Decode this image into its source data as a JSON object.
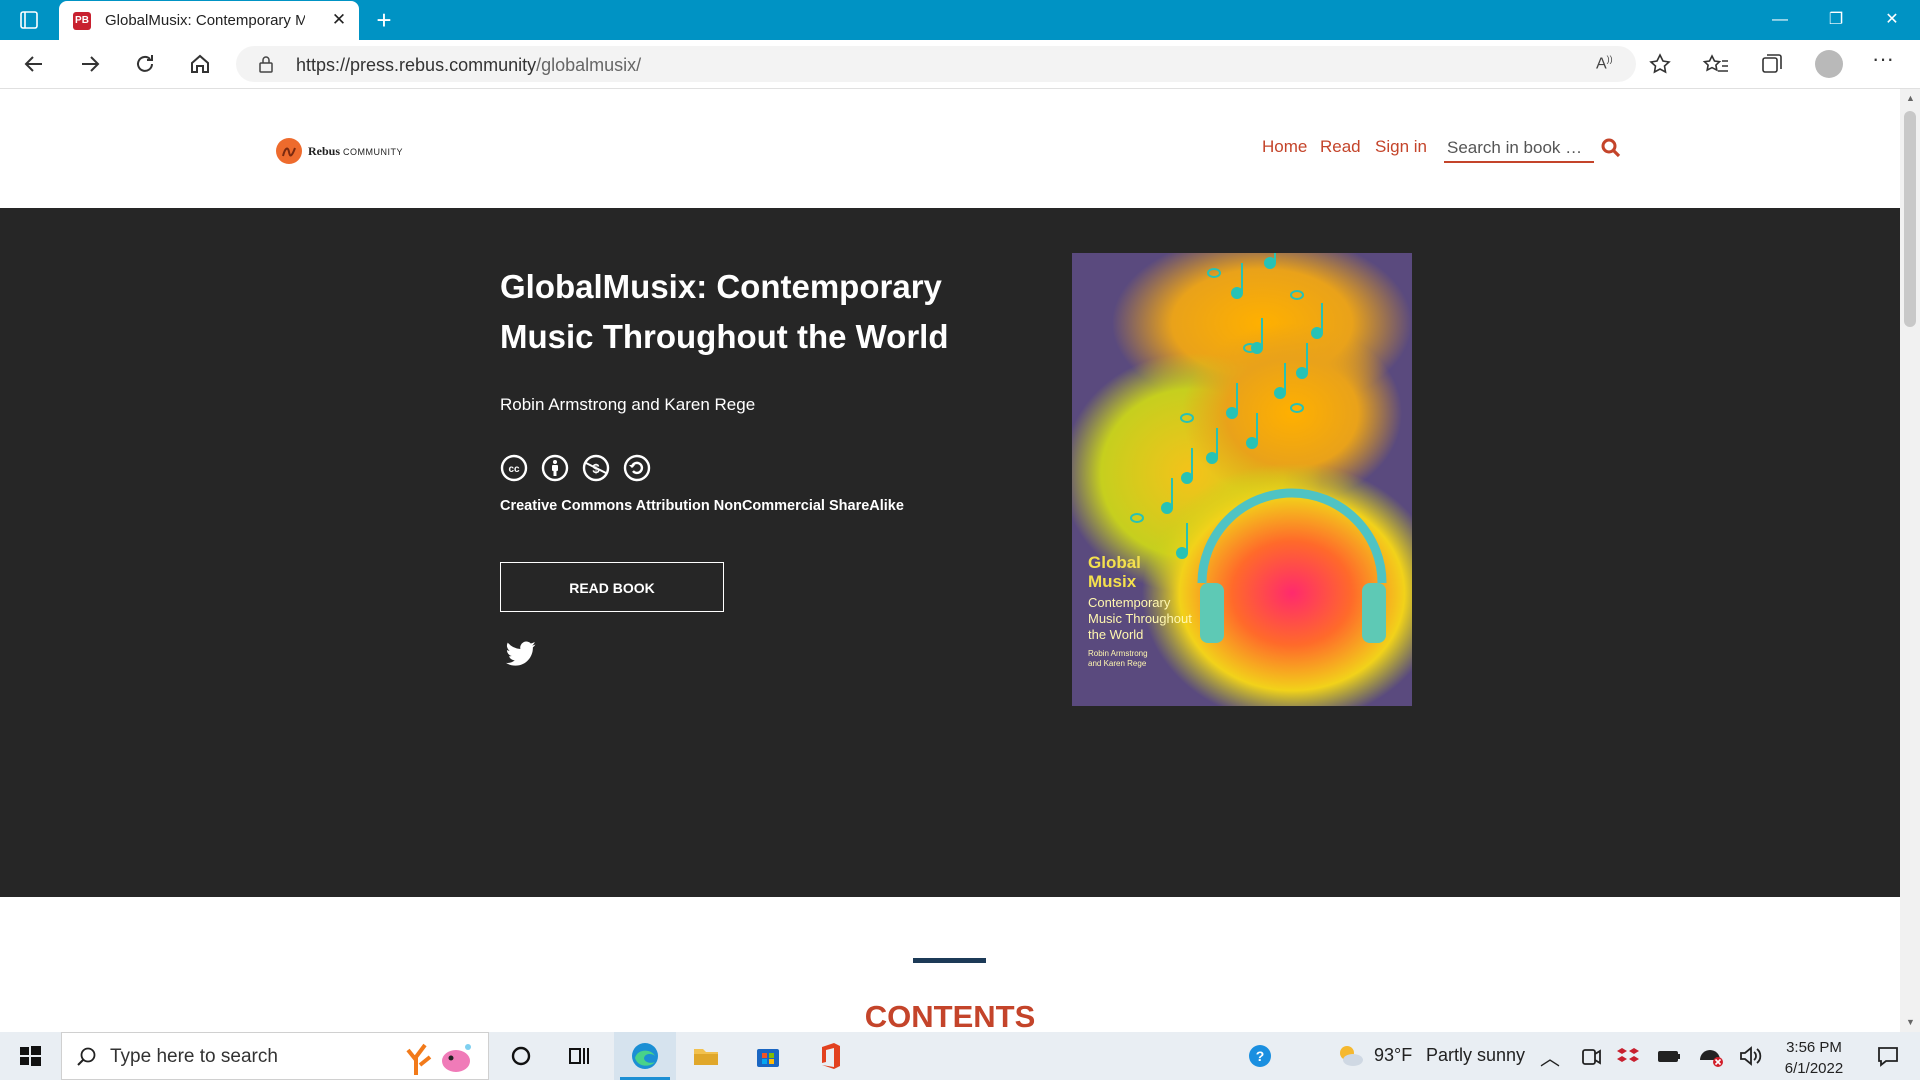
{
  "browser": {
    "tab_title": "GlobalMusix: Contemporary Mus",
    "tab_favicon": "PB",
    "url_host": "https://press.rebus.community",
    "url_path": "/globalmusix/"
  },
  "site": {
    "logo_name": "Rebus",
    "logo_sub": "COMMUNITY",
    "nav": {
      "home": "Home",
      "read": "Read",
      "sign_in": "Sign in"
    },
    "search_placeholder": "Search in book …"
  },
  "book": {
    "title": "GlobalMusix: Contemporary Music Throughout the World",
    "authors": "Robin Armstrong and Karen Rege",
    "license": "Creative Commons Attribution NonCommercial ShareAlike",
    "read_button": "READ BOOK",
    "cover": {
      "title_line1": "Global",
      "title_line2": "Musix",
      "subtitle": "Contemporary Music Throughout the World",
      "authors_line1": "Robin Armstrong",
      "authors_line2": "and Karen Rege"
    }
  },
  "contents_heading": "CONTENTS",
  "taskbar": {
    "search_placeholder": "Type here to search",
    "weather_temp": "93°F",
    "weather_desc": "Partly sunny",
    "time": "3:56 PM",
    "date": "6/1/2022"
  },
  "colors": {
    "accent": "#c4442a",
    "hero_bg": "#262626",
    "browser_titlebar": "#0093c4",
    "contents_bar": "#1c3a57"
  }
}
